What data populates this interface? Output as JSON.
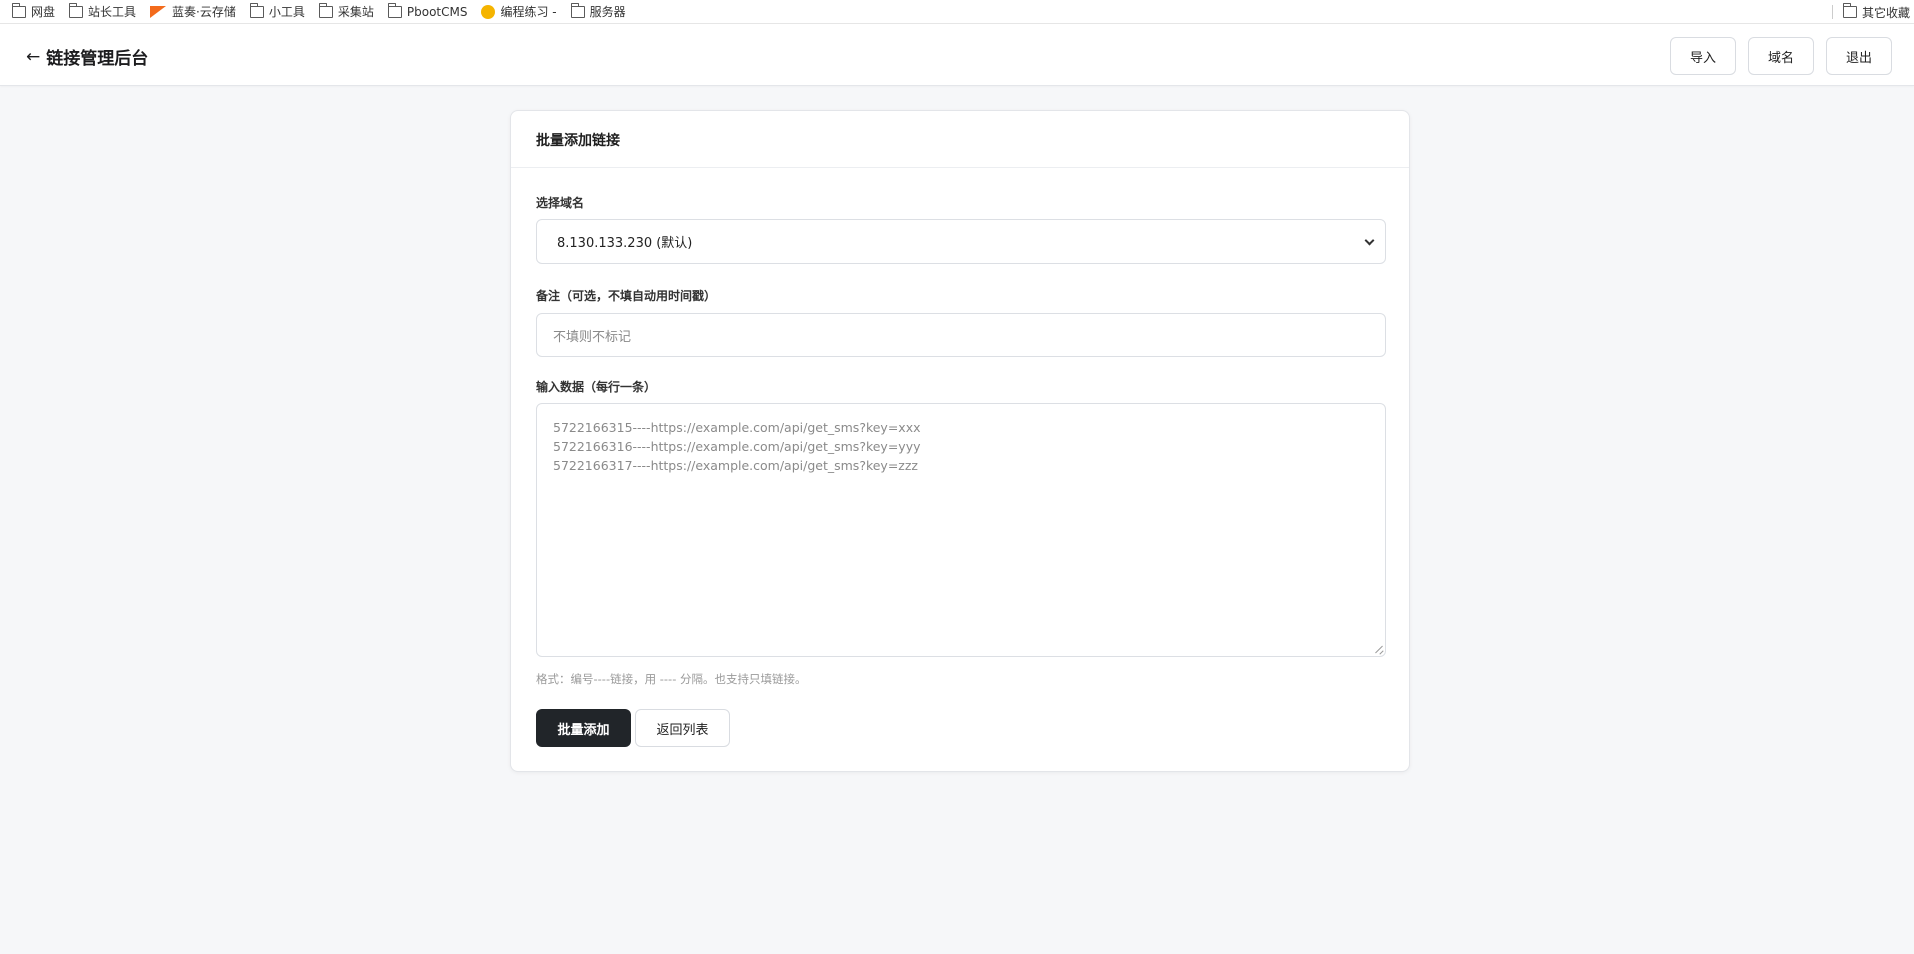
{
  "bookmarks": {
    "items": [
      {
        "label": "网盘",
        "icon": "folder-icon"
      },
      {
        "label": "站长工具",
        "icon": "folder-icon"
      },
      {
        "label": "蓝奏·云存储",
        "icon": "lanzou-logo-icon"
      },
      {
        "label": "小工具",
        "icon": "folder-icon"
      },
      {
        "label": "采集站",
        "icon": "folder-icon"
      },
      {
        "label": "PbootCMS",
        "icon": "folder-icon"
      },
      {
        "label": "编程练习 -",
        "icon": "emoji-icon"
      },
      {
        "label": "服务器",
        "icon": "folder-icon"
      }
    ],
    "other": {
      "label": "其它收藏",
      "icon": "folder-icon"
    }
  },
  "header": {
    "back_arrow": "←",
    "title": "链接管理后台",
    "buttons": {
      "import": "导入",
      "domain": "域名",
      "logout": "退出"
    }
  },
  "card": {
    "title": "批量添加链接",
    "domain_label": "选择域名",
    "domain_selected": "8.130.133.230 (默认)",
    "note_label": "备注（可选，不填自动用时间戳）",
    "note_placeholder": "不填则不标记",
    "data_label": "输入数据（每行一条）",
    "data_placeholder_lines": [
      "5722166315----https://example.com/api/get_sms?key=xxx",
      "5722166316----https://example.com/api/get_sms?key=yyy",
      "5722166317----https://example.com/api/get_sms?key=zzz"
    ],
    "hint": "格式：编号----链接，用 ---- 分隔。也支持只填链接。",
    "submit": "批量添加",
    "back_to_list": "返回列表"
  }
}
